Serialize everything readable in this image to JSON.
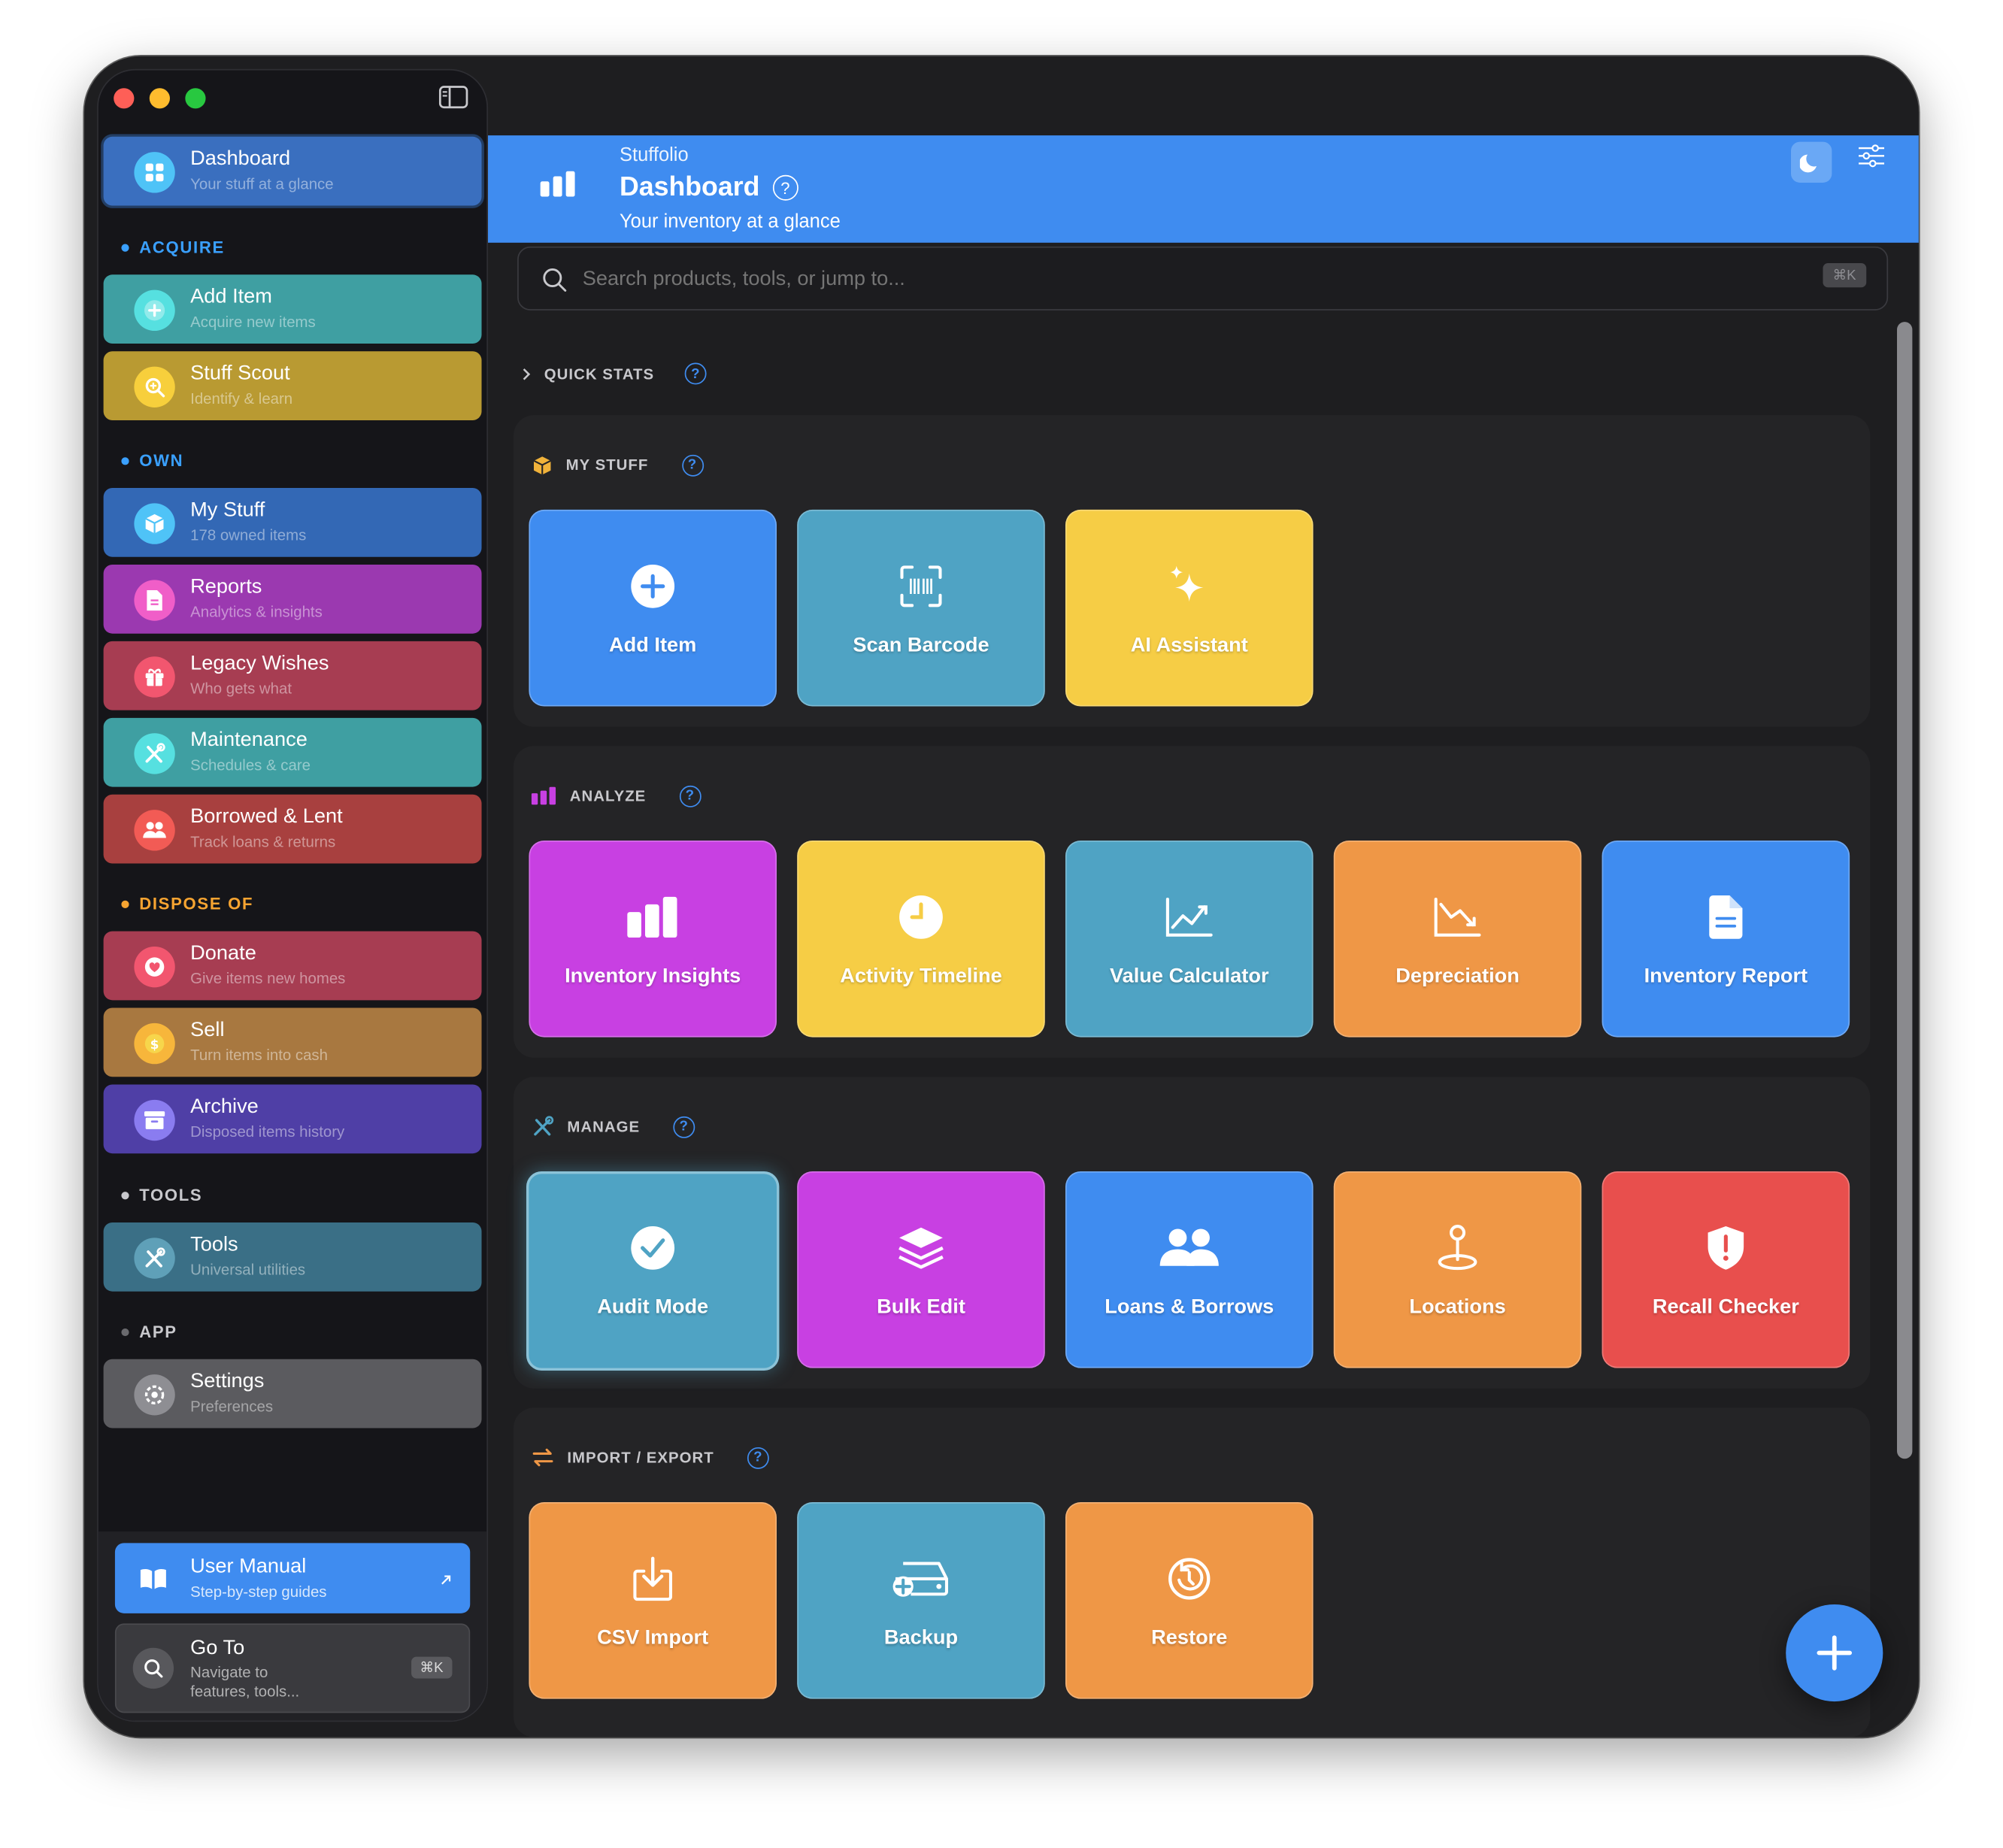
{
  "app": {
    "name": "Stuffolio",
    "title": "Dashboard",
    "subtitle": "Your inventory at a glance"
  },
  "search": {
    "placeholder": "Search products, tools, or jump to...",
    "shortcut": "⌘K"
  },
  "sidebar": {
    "dashboard": {
      "label": "Dashboard",
      "sub": "Your stuff at a glance",
      "color": "#3a6fbf"
    },
    "sections": {
      "acquire": {
        "label": "ACQUIRE",
        "color": "#3aa0ff"
      },
      "own": {
        "label": "OWN",
        "color": "#3aa0ff"
      },
      "dispose": {
        "label": "DISPOSE OF",
        "color": "#f7a431"
      },
      "tools": {
        "label": "TOOLS",
        "color": "#c8c8cc"
      },
      "app": {
        "label": "APP",
        "color": "#c8c8cc"
      }
    },
    "items": {
      "add_item": {
        "label": "Add Item",
        "sub": "Acquire new items",
        "color": "#3f9fa2"
      },
      "stuff_scout": {
        "label": "Stuff Scout",
        "sub": "Identify & learn",
        "color": "#b99a32"
      },
      "my_stuff": {
        "label": "My Stuff",
        "sub": "178 owned items",
        "color": "#3368b5"
      },
      "reports": {
        "label": "Reports",
        "sub": "Analytics & insights",
        "color": "#9b39b0"
      },
      "legacy": {
        "label": "Legacy Wishes",
        "sub": "Who gets what",
        "color": "#a73d52"
      },
      "maintenance": {
        "label": "Maintenance",
        "sub": "Schedules & care",
        "color": "#3f9fa2"
      },
      "borrowed": {
        "label": "Borrowed & Lent",
        "sub": "Track loans & returns",
        "color": "#a8403f"
      },
      "donate": {
        "label": "Donate",
        "sub": "Give items new homes",
        "color": "#a73d52"
      },
      "sell": {
        "label": "Sell",
        "sub": "Turn items into cash",
        "color": "#a87840"
      },
      "archive": {
        "label": "Archive",
        "sub": "Disposed items history",
        "color": "#4f3fa6"
      },
      "tools": {
        "label": "Tools",
        "sub": "Universal utilities",
        "color": "#3a6f86"
      },
      "settings": {
        "label": "Settings",
        "sub": "Preferences",
        "color": "#5b5b5f"
      }
    },
    "footer": {
      "manual": {
        "label": "User Manual",
        "sub": "Step-by-step guides"
      },
      "goto": {
        "label": "Go To",
        "sub1": "Navigate to",
        "sub2": "features, tools...",
        "shortcut": "⌘K"
      }
    }
  },
  "main": {
    "quick_stats": "QUICK STATS",
    "sections": {
      "my_stuff": {
        "title": "MY STUFF",
        "tiles": [
          {
            "label": "Add Item",
            "icon": "plus-circle-icon",
            "color": "#3f8cf0"
          },
          {
            "label": "Scan Barcode",
            "icon": "barcode-scan-icon",
            "color": "#4fa3c4"
          },
          {
            "label": "AI Assistant",
            "icon": "sparkles-icon",
            "color": "#f6cd45"
          }
        ]
      },
      "analyze": {
        "title": "ANALYZE",
        "tiles": [
          {
            "label": "Inventory Insights",
            "icon": "bar-chart-icon",
            "color": "#c840e2"
          },
          {
            "label": "Activity Timeline",
            "icon": "clock-icon",
            "color": "#f6cd45"
          },
          {
            "label": "Value Calculator",
            "icon": "line-chart-icon",
            "color": "#4fa3c4"
          },
          {
            "label": "Depreciation",
            "icon": "chart-down-icon",
            "color": "#ef9746"
          },
          {
            "label": "Inventory Report",
            "icon": "document-icon",
            "color": "#3f8cf0"
          }
        ]
      },
      "manage": {
        "title": "MANAGE",
        "tiles": [
          {
            "label": "Audit Mode",
            "icon": "checkmark-circle-icon",
            "color": "#4fa3c4"
          },
          {
            "label": "Bulk Edit",
            "icon": "layers-icon",
            "color": "#c840e2"
          },
          {
            "label": "Loans & Borrows",
            "icon": "people-icon",
            "color": "#3f8cf0"
          },
          {
            "label": "Locations",
            "icon": "map-pin-icon",
            "color": "#ef9746"
          },
          {
            "label": "Recall Checker",
            "icon": "shield-alert-icon",
            "color": "#e84f4d"
          }
        ]
      },
      "import_export": {
        "title": "IMPORT / EXPORT",
        "tiles": [
          {
            "label": "CSV Import",
            "icon": "import-icon",
            "color": "#ef9746"
          },
          {
            "label": "Backup",
            "icon": "backup-drive-icon",
            "color": "#4fa3c4"
          },
          {
            "label": "Restore",
            "icon": "restore-icon",
            "color": "#ef9746"
          }
        ]
      }
    }
  }
}
